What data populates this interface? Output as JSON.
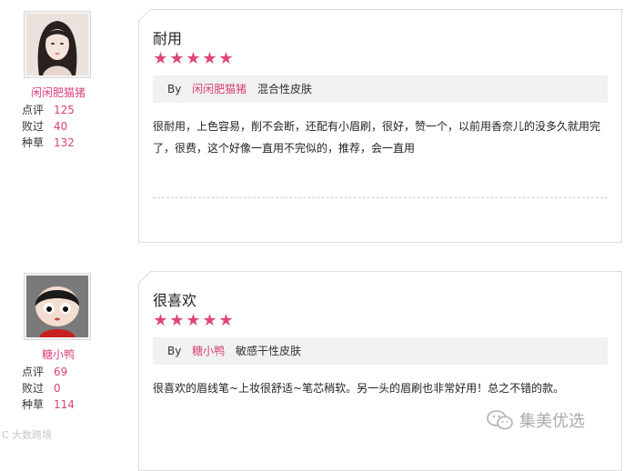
{
  "reviews": [
    {
      "username": "闲闲肥猫猪",
      "stats": [
        {
          "label": "点评",
          "value": "125"
        },
        {
          "label": "败过",
          "value": "40"
        },
        {
          "label": "种草",
          "value": "132"
        }
      ],
      "title": "耐用",
      "rating": 5,
      "by_label": "By",
      "by_user": "闲闲肥猫猪",
      "skin_type": "混合性皮肤",
      "body": "很耐用，上色容易，削不会断，还配有小眉刷，很好，赞一个，以前用香奈儿的没多久就用完了，很费，这个好像一直用不完似的，推荐，会一直用"
    },
    {
      "username": "糖小鸭",
      "stats": [
        {
          "label": "点评",
          "value": "69"
        },
        {
          "label": "败过",
          "value": "0"
        },
        {
          "label": "种草",
          "value": "114"
        }
      ],
      "title": "很喜欢",
      "rating": 5,
      "by_label": "By",
      "by_user": "糖小鸭",
      "skin_type": "敏感干性皮肤",
      "body": "很喜欢的眉线笔~上妆很舒适~笔芯稍软。另一头的眉刷也非常好用！总之不错的款。"
    }
  ],
  "watermark_left": "C 大数跨境",
  "watermark_right": "集美优选",
  "colors": {
    "accent": "#d8427a",
    "star": "#e0457b"
  },
  "icons": {
    "rating": "star-icon",
    "watermark": "wechat-icon"
  }
}
